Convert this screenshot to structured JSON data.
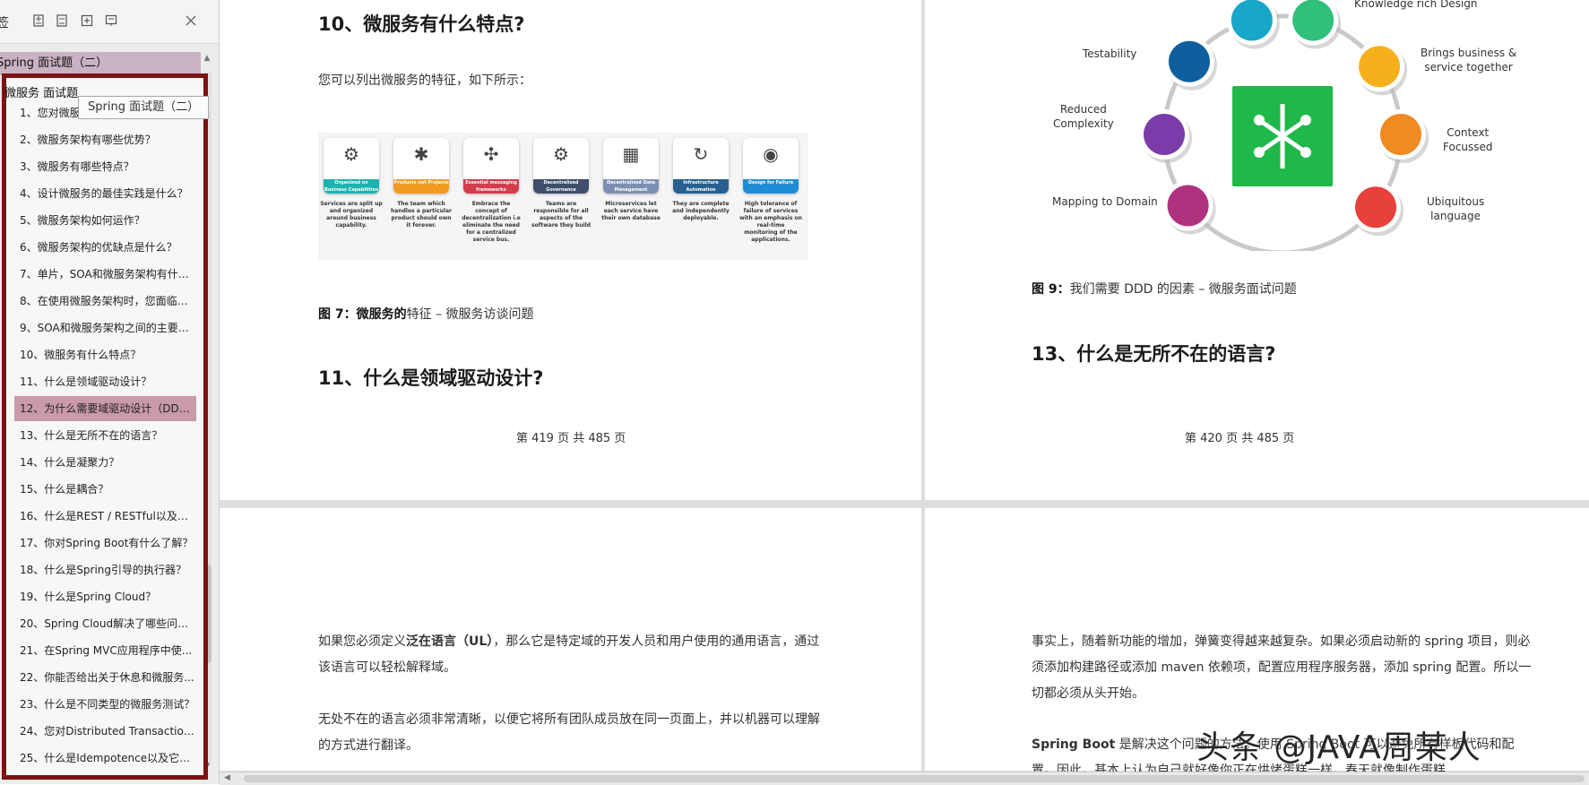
{
  "sidebar": {
    "title_fragment": "签",
    "section_header": "Spring 面试题（二）",
    "root_item": "微服务 面试题",
    "tooltip": "Spring 面试题（二）",
    "items": [
      {
        "label": "1、您对微服务有何了解？"
      },
      {
        "label": "2、微服务架构有哪些优势？"
      },
      {
        "label": "3、微服务有哪些特点？"
      },
      {
        "label": "4、设计微服务的最佳实践是什么？"
      },
      {
        "label": "5、微服务架构如何运作？"
      },
      {
        "label": "6、微服务架构的优缺点是什么？"
      },
      {
        "label": "7、单片，SOA和微服务架构有什么..."
      },
      {
        "label": "8、在使用微服务架构时，您面临哪..."
      },
      {
        "label": "9、SOA和微服务架构之间的主要区..."
      },
      {
        "label": "10、微服务有什么特点？"
      },
      {
        "label": "11、什么是领域驱动设计？"
      },
      {
        "label": "12、为什么需要域驱动设计（DDD..."
      },
      {
        "label": "13、什么是无所不在的语言？"
      },
      {
        "label": "14、什么是凝聚力？"
      },
      {
        "label": "15、什么是耦合？"
      },
      {
        "label": "16、什么是REST / RESTful以及它..."
      },
      {
        "label": "17、你对Spring Boot有什么了解？"
      },
      {
        "label": "18、什么是Spring引导的执行器？"
      },
      {
        "label": "19、什么是Spring Cloud？"
      },
      {
        "label": "20、Spring Cloud解决了哪些问题？"
      },
      {
        "label": "21、在Spring MVC应用程序中使..."
      },
      {
        "label": "22、你能否给出关于休息和微服务..."
      },
      {
        "label": "23、什么是不同类型的微服务测试？"
      },
      {
        "label": "24、您对Distributed Transaction..."
      },
      {
        "label": "25、什么是Idempotence以及它在..."
      }
    ],
    "active_index": 11,
    "icons": [
      "expand-all-icon",
      "collapse-all-icon",
      "add-bookmark-icon",
      "bookmark-properties-icon",
      "close-icon"
    ]
  },
  "page419": {
    "heading": "10、微服务有什么特点?",
    "intro": "您可以列出微服务的特征，如下所示：",
    "features": [
      {
        "tag": "Organized on Business Capabilities",
        "desc": "Services are split up and organized around business capability.",
        "color": "#19b3b0",
        "glyph": "⚙"
      },
      {
        "tag": "Products not Projects",
        "desc": "The team which handles a particular product should own it forever.",
        "color": "#f29a1f",
        "glyph": "✱"
      },
      {
        "tag": "Essential messaging frameworks",
        "desc": "Embrace the concept of decentralization i.e eliminate the need for a centralized service bus.",
        "color": "#d43c4c",
        "glyph": "✣"
      },
      {
        "tag": "Decentralized Governance",
        "desc": "Teams are responsible for all aspects of the software they build",
        "color": "#3f4f6b",
        "glyph": "⚙"
      },
      {
        "tag": "Decentralized Data Management",
        "desc": "Microservices let each service have their own database",
        "color": "#7b8fb2",
        "glyph": "▦"
      },
      {
        "tag": "Infrastructure Automation",
        "desc": "They are complete and independently deployable.",
        "color": "#27608f",
        "glyph": "↻"
      },
      {
        "tag": "Design for Failure",
        "desc": "High tolerance of failure of services with an emphasis on real-time monitoring of the applications.",
        "color": "#1f8dd6",
        "glyph": "◉"
      }
    ],
    "caption_prefix": "图 7",
    "caption_bold": "微服务的",
    "caption_rest": "特征 – 微服务访谈问题",
    "heading2": "11、什么是领域驱动设计?",
    "page_number": "第 419 页 共 485 页"
  },
  "page420": {
    "wheel_labels": {
      "top": "Knowledge rich Design",
      "testability": "Testability",
      "business": "Brings business &\nservice together",
      "complexity": "Reduced\nComplexity",
      "context": "Context\nFocussed",
      "mapping": "Mapping to Domain",
      "ubiquitous": "Ubiquitous\nlanguage"
    },
    "wheel_colors": [
      "#18a7c8",
      "#2fc07a",
      "#f5b01b",
      "#f08a22",
      "#e8413c",
      "#b0327e",
      "#7a3ca8",
      "#0e5fa0"
    ],
    "caption_prefix": "图 9",
    "caption_rest": "我们需要 DDD 的因素 – 微服务面试问题",
    "heading": "13、什么是无所不在的语言?",
    "page_number": "第 420 页 共 485 页"
  },
  "page421": {
    "p1_start": "如果您必须定义",
    "p1_bold": "泛在语言（UL）",
    "p1_end": "，那么它是特定域的开发人员和用户使用的通用语言，通过该语言可以轻松解释域。",
    "p2": "无处不在的语言必须非常清晰，以便它将所有团队成员放在同一页面上，并以机器可以理解的方式进行翻译。"
  },
  "page422": {
    "p1": "事实上，随着新功能的增加，弹簧变得越来越复杂。如果必须启动新的 spring 项目，则必须添加构建路径或添加 maven 依赖项，配置应用程序服务器，添加 spring 配置。所以一切都必须从头开始。",
    "p2_bold": "Spring Boot",
    "p2_rest": " 是解决这个问题的方法。使用 Spring Boot 可以避免所有样板代码和配置。因此，基本上认为自己就好像你正在烘烤蛋糕一样，春天就像制作蛋糕"
  },
  "watermark": "头条 @JAVA周某人"
}
